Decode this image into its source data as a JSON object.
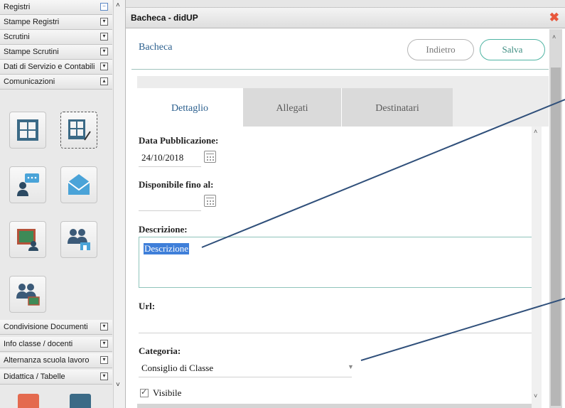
{
  "sidebar": {
    "menus_top": [
      {
        "label": "Registri",
        "toggle": "−"
      },
      {
        "label": "Stampe Registri",
        "toggle": "▾"
      },
      {
        "label": "Scrutini",
        "toggle": "▾"
      },
      {
        "label": "Stampe Scrutini",
        "toggle": "▾"
      },
      {
        "label": "Dati di Servizio e Contabili",
        "toggle": "▾"
      },
      {
        "label": "Comunicazioni",
        "toggle": "▴"
      }
    ],
    "menus_bottom": [
      {
        "label": "Condivisione Documenti",
        "toggle": "▾"
      },
      {
        "label": "Info classe / docenti",
        "toggle": "▾"
      },
      {
        "label": "Alternanza scuola lavoro",
        "toggle": "▾"
      },
      {
        "label": "Didattica / Tabelle",
        "toggle": "▾"
      }
    ],
    "icons": [
      "bacheca-grid-icon",
      "bacheca-edit-icon",
      "chat-person-icon",
      "envelope-icon",
      "blackboard-teacher-icon",
      "group-school-icon",
      "group-board-icon"
    ]
  },
  "dialog": {
    "title": "Bacheca - didUP",
    "close_symbol": "✖",
    "header_title": "Bacheca",
    "back_label": "Indietro",
    "save_label": "Salva",
    "tabs": [
      {
        "label": "Dettaglio",
        "active": true
      },
      {
        "label": "Allegati",
        "active": false
      },
      {
        "label": "Destinatari",
        "active": false
      }
    ],
    "form": {
      "pub_label": "Data Pubblicazione:",
      "pub_value": "24/10/2018",
      "until_label": "Disponibile fino al:",
      "until_value": "",
      "desc_label": "Descrizione:",
      "desc_value": "Descrizione",
      "url_label": "Url:",
      "url_value": "",
      "category_label": "Categoria:",
      "category_value": "Consiglio di Classe",
      "visible_label": "Visibile",
      "visible_checked": true
    }
  },
  "colors": {
    "accent_teal": "#4fb4a3",
    "title_blue": "#2b5f8e",
    "close_red": "#e8573c",
    "selection_blue": "#3f7fd9",
    "annotation_line": "#2f4f7a"
  }
}
